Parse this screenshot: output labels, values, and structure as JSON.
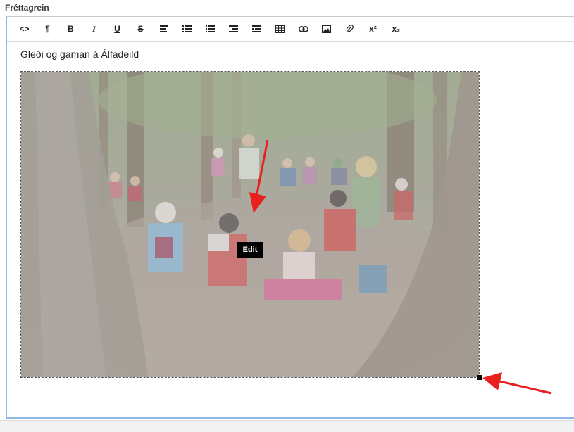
{
  "field": {
    "label": "Fréttagrein"
  },
  "toolbar": {
    "buttons": [
      {
        "name": "source-code",
        "glyph": "<>"
      },
      {
        "name": "paragraph",
        "glyph": "¶"
      },
      {
        "name": "bold",
        "glyph": "B"
      },
      {
        "name": "italic",
        "glyph": "I"
      },
      {
        "name": "underline",
        "glyph": "U"
      },
      {
        "name": "strikethrough",
        "glyph": "S"
      },
      {
        "name": "align",
        "glyph": ""
      },
      {
        "name": "unordered-list",
        "glyph": ""
      },
      {
        "name": "ordered-list",
        "glyph": ""
      },
      {
        "name": "outdent",
        "glyph": ""
      },
      {
        "name": "indent",
        "glyph": ""
      },
      {
        "name": "table",
        "glyph": ""
      },
      {
        "name": "link",
        "glyph": ""
      },
      {
        "name": "image",
        "glyph": ""
      },
      {
        "name": "attachment",
        "glyph": ""
      },
      {
        "name": "superscript",
        "glyph": "x²"
      },
      {
        "name": "subscript",
        "glyph": "x₂"
      }
    ]
  },
  "content": {
    "headline": "Gleði og gaman á Álfadeild",
    "tooltip": "Edit"
  },
  "colors": {
    "focus_border": "#8fb8e6",
    "arrow": "#e8201e"
  }
}
